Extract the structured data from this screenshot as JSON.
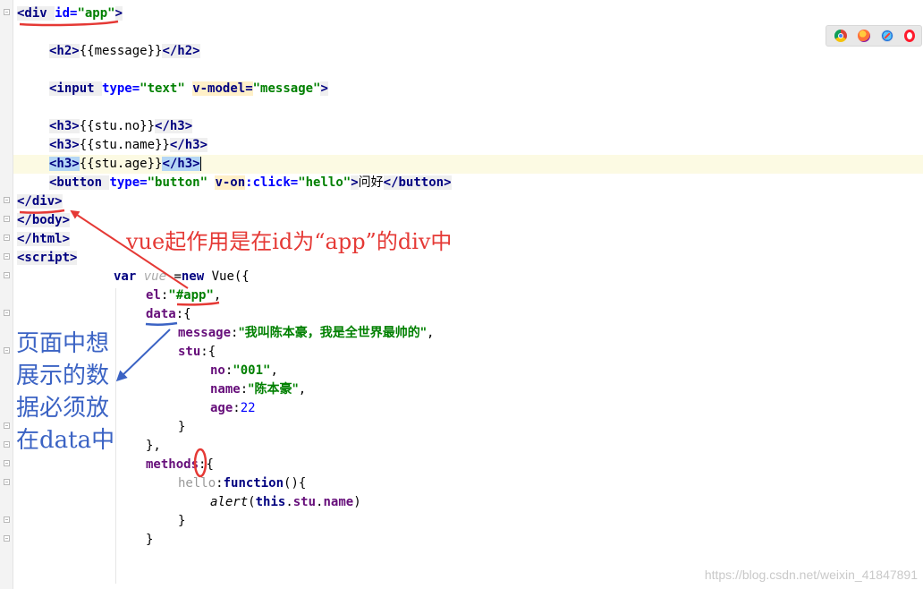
{
  "editor": {
    "lines": [
      {
        "tokens": [
          {
            "t": "<div ",
            "c": "t-tag"
          },
          {
            "t": "id=",
            "c": "t-attr"
          },
          {
            "t": "\"app\"",
            "c": "t-val"
          },
          {
            "t": ">",
            "c": "t-tag"
          }
        ]
      },
      {
        "tokens": []
      },
      {
        "tokens": [
          {
            "t": "<h2>",
            "c": "t-tag"
          },
          {
            "t": "{{message}}",
            "c": "t-plain"
          },
          {
            "t": "</h2>",
            "c": "t-tag"
          }
        ]
      },
      {
        "tokens": []
      },
      {
        "tokens": [
          {
            "t": "<input ",
            "c": "t-tag"
          },
          {
            "t": "type=",
            "c": "t-attr"
          },
          {
            "t": "\"text\" ",
            "c": "t-val"
          },
          {
            "t": "v-model=",
            "c": "t-vue"
          },
          {
            "t": "\"message\"",
            "c": "t-val"
          },
          {
            "t": ">",
            "c": "t-tag"
          }
        ]
      },
      {
        "tokens": []
      },
      {
        "tokens": [
          {
            "t": "<h3>",
            "c": "t-tag"
          },
          {
            "t": "{{stu.no}}",
            "c": "t-plain"
          },
          {
            "t": "</h3>",
            "c": "t-tag"
          }
        ]
      },
      {
        "tokens": [
          {
            "t": "<h3>",
            "c": "t-tag"
          },
          {
            "t": "{{stu.name}}",
            "c": "t-plain"
          },
          {
            "t": "</h3>",
            "c": "t-tag"
          }
        ]
      },
      {
        "tokens": [
          {
            "t": "<h3>",
            "c": "t-tagm"
          },
          {
            "t": "{{stu.age}}",
            "c": "t-plain"
          },
          {
            "t": "</h3>",
            "c": "t-tagm"
          },
          {
            "t": "",
            "c": "caret"
          }
        ]
      },
      {
        "tokens": [
          {
            "t": "<button ",
            "c": "t-tag"
          },
          {
            "t": "type=",
            "c": "t-attr"
          },
          {
            "t": "\"button\" ",
            "c": "t-val"
          },
          {
            "t": "v-on",
            "c": "t-vue"
          },
          {
            "t": ":click=",
            "c": "t-attr"
          },
          {
            "t": "\"hello\"",
            "c": "t-val"
          },
          {
            "t": ">",
            "c": "t-tag"
          },
          {
            "t": "问好",
            "c": "t-plain t-cjk"
          },
          {
            "t": "</button>",
            "c": "t-tag"
          }
        ]
      },
      {
        "tokens": [
          {
            "t": "</div>",
            "c": "t-tag"
          }
        ]
      },
      {
        "tokens": [
          {
            "t": "</body>",
            "c": "t-tag"
          }
        ]
      },
      {
        "tokens": [
          {
            "t": "</html>",
            "c": "t-tag"
          }
        ]
      },
      {
        "tokens": [
          {
            "t": "<script>",
            "c": "t-tag"
          }
        ]
      },
      {
        "tokens": [
          {
            "t": "var ",
            "c": "t-kw"
          },
          {
            "t": "vue ",
            "c": "t-var"
          },
          {
            "t": "=",
            "c": "t-plain"
          },
          {
            "t": "new ",
            "c": "t-kw"
          },
          {
            "t": "Vue({",
            "c": "t-plain"
          }
        ]
      },
      {
        "tokens": [
          {
            "t": "el",
            "c": "t-prop"
          },
          {
            "t": ":",
            "c": "t-plain"
          },
          {
            "t": "\"#app\"",
            "c": "t-str"
          },
          {
            "t": ",",
            "c": "t-plain"
          }
        ]
      },
      {
        "tokens": [
          {
            "t": "data",
            "c": "t-prop"
          },
          {
            "t": ":{",
            "c": "t-plain"
          }
        ]
      },
      {
        "tokens": [
          {
            "t": "message",
            "c": "t-prop"
          },
          {
            "t": ":",
            "c": "t-plain"
          },
          {
            "t": "\"我叫陈本豪，我是全世界最帅的\"",
            "c": "t-str t-cjk"
          },
          {
            "t": ",",
            "c": "t-plain"
          }
        ]
      },
      {
        "tokens": [
          {
            "t": "stu",
            "c": "t-prop"
          },
          {
            "t": ":{",
            "c": "t-plain"
          }
        ]
      },
      {
        "tokens": [
          {
            "t": "no",
            "c": "t-prop"
          },
          {
            "t": ":",
            "c": "t-plain"
          },
          {
            "t": "\"001\"",
            "c": "t-str"
          },
          {
            "t": ",",
            "c": "t-plain"
          }
        ]
      },
      {
        "tokens": [
          {
            "t": "name",
            "c": "t-prop"
          },
          {
            "t": ":",
            "c": "t-plain"
          },
          {
            "t": "\"陈本豪\"",
            "c": "t-str t-cjk"
          },
          {
            "t": ",",
            "c": "t-plain"
          }
        ]
      },
      {
        "tokens": [
          {
            "t": "age",
            "c": "t-prop"
          },
          {
            "t": ":",
            "c": "t-plain"
          },
          {
            "t": "22",
            "c": "t-num"
          }
        ]
      },
      {
        "tokens": [
          {
            "t": "}",
            "c": "t-plain"
          }
        ]
      },
      {
        "tokens": [
          {
            "t": "},",
            "c": "t-plain"
          }
        ]
      },
      {
        "tokens": [
          {
            "t": "methods",
            "c": "t-prop"
          },
          {
            "t": ":{",
            "c": "t-plain"
          }
        ]
      },
      {
        "tokens": [
          {
            "t": "hello",
            "c": "t-gray"
          },
          {
            "t": ":",
            "c": "t-plain"
          },
          {
            "t": "function",
            "c": "t-kw"
          },
          {
            "t": "(){",
            "c": "t-plain"
          }
        ]
      },
      {
        "tokens": [
          {
            "t": "alert",
            "c": "t-ital"
          },
          {
            "t": "(",
            "c": "t-plain"
          },
          {
            "t": "this",
            "c": "t-kw"
          },
          {
            "t": ".",
            "c": "t-plain"
          },
          {
            "t": "stu",
            "c": "t-prop"
          },
          {
            "t": ".",
            "c": "t-plain"
          },
          {
            "t": "name",
            "c": "t-prop"
          },
          {
            "t": ")",
            "c": "t-plain"
          }
        ]
      },
      {
        "tokens": [
          {
            "t": "}",
            "c": "t-plain"
          }
        ]
      },
      {
        "tokens": [
          {
            "t": "}",
            "c": "t-plain"
          }
        ]
      }
    ]
  },
  "annotations": {
    "red": "vue起作用是在id为“app”的div中",
    "blue": "页面中想展示的数据必须放在data中"
  },
  "browser_icons": [
    "chrome-icon",
    "firefox-icon",
    "safari-icon",
    "opera-icon"
  ],
  "watermark": "https://blog.csdn.net/weixin_41847891"
}
